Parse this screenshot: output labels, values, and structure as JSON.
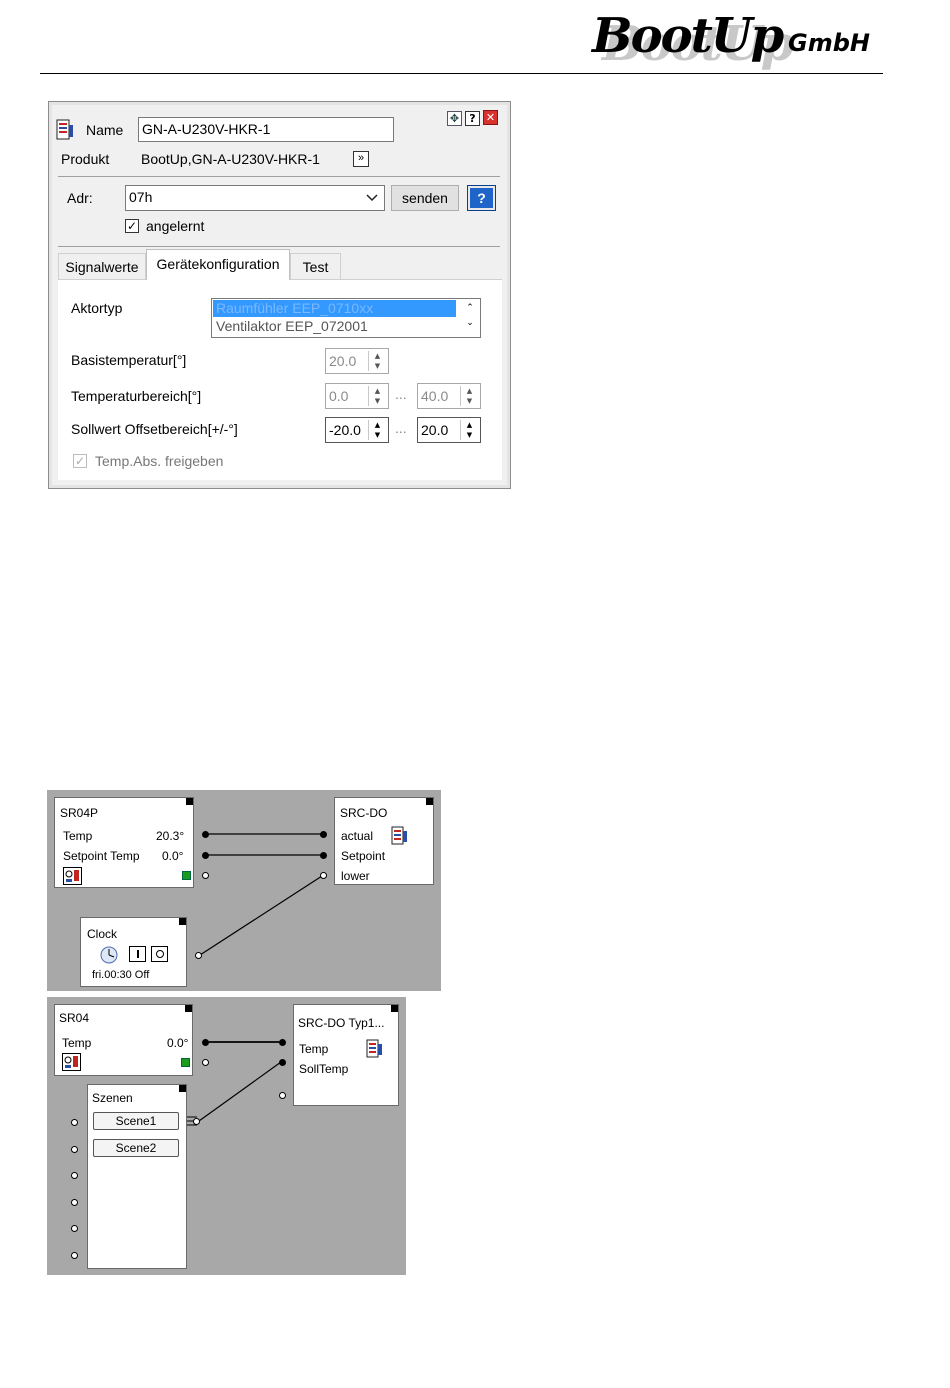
{
  "header": {
    "logo_text": "BootUp",
    "logo_suffix": "GmbH"
  },
  "dialog": {
    "name_label": "Name",
    "name_value": "GN-A-U230V-HKR-1",
    "product_label": "Produkt",
    "product_value": "BootUp,GN-A-U230V-HKR-1",
    "product_more": "»",
    "adr_label": "Adr:",
    "adr_value": "07h",
    "send_label": "senden",
    "help_label": "?",
    "learned_label": "angelernt",
    "title_buttons": {
      "move": "✥",
      "help": "?",
      "close": "✕"
    },
    "tabs": [
      {
        "label": "Signalwerte"
      },
      {
        "label": "Gerätekonfiguration"
      },
      {
        "label": "Test"
      }
    ],
    "config": {
      "actuator_type_label": "Aktortyp",
      "actuator_options": [
        "Raumfühler EEP_0710xx",
        "Ventilaktor EEP_072001"
      ],
      "base_temp_label": "Basistemperatur[°]",
      "base_temp_value": "20.0",
      "temp_range_label": "Temperaturbereich[°]",
      "temp_range_min": "0.0",
      "temp_range_max": "40.0",
      "offset_range_label": "Sollwert Offsetbereich[+/-°]",
      "offset_min": "-20.0",
      "offset_max": "20.0",
      "range_separator": "...",
      "temp_abs_label": "Temp.Abs. freigeben"
    }
  },
  "diagram1": {
    "sr04p": {
      "title": "SR04P",
      "rows": [
        {
          "label": "Temp",
          "value": "20.3°"
        },
        {
          "label": "Setpoint Temp",
          "value": "0.0°"
        }
      ]
    },
    "src": {
      "title": "SRC-DO",
      "rows": [
        "actual",
        "Setpoint",
        "lower"
      ]
    },
    "clock": {
      "title": "Clock",
      "status": "fri.00:30 Off"
    }
  },
  "diagram2": {
    "sr04": {
      "title": "SR04",
      "rows": [
        {
          "label": "Temp",
          "value": "0.0°"
        }
      ]
    },
    "src": {
      "title": "SRC-DO Typ1...",
      "rows": [
        "Temp",
        "SollTemp"
      ]
    },
    "scenes": {
      "title": "Szenen",
      "buttons": [
        "Scene1",
        "Scene2"
      ]
    }
  },
  "colors": {
    "selection": "#3399ff",
    "canvas": "#a8a8a8",
    "help_blue": "#1f64c8",
    "close_red": "#d8322e"
  }
}
